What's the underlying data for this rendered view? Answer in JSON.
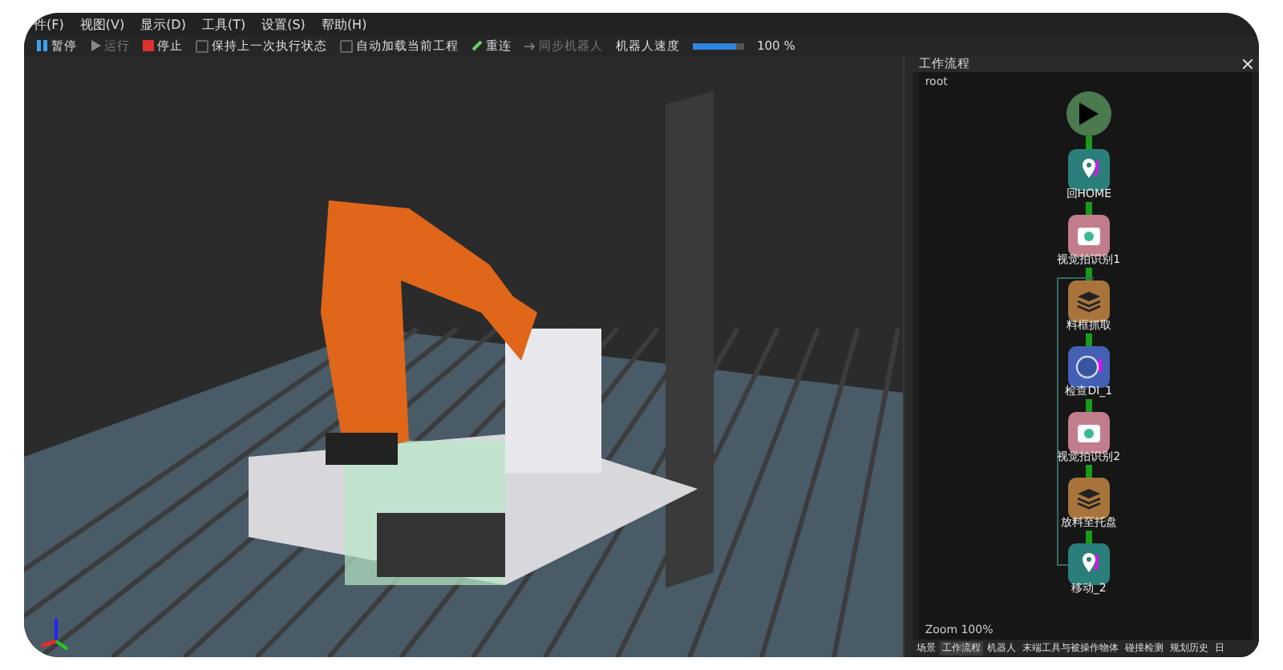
{
  "menu": [
    "件(F)",
    "视图(V)",
    "显示(D)",
    "工具(T)",
    "设置(S)",
    "帮助(H)"
  ],
  "toolbar": {
    "items": [
      {
        "kind": "pause",
        "label": "暂停",
        "disabled": false
      },
      {
        "kind": "run",
        "label": "运行",
        "disabled": true
      },
      {
        "kind": "stop",
        "label": "停止",
        "disabled": false
      },
      {
        "kind": "check",
        "label": "保持上一次执行状态",
        "checked": false
      },
      {
        "kind": "check",
        "label": "自动加载当前工程",
        "checked": false
      },
      {
        "kind": "link",
        "label": "重连",
        "disabled": false
      },
      {
        "kind": "sync",
        "label": "同步机器人",
        "disabled": true
      }
    ],
    "speed": {
      "label": "机器人速度",
      "level": 0.85,
      "value": "100 %"
    }
  },
  "workflow": {
    "title": "工作流程",
    "path": "root",
    "zoom": "Zoom 100%",
    "nodes": [
      {
        "kind": "start"
      },
      {
        "kind": "move",
        "label": "回HOME",
        "color": "#2a7f7a"
      },
      {
        "kind": "camera",
        "label": "视觉拍识别1",
        "color": "#c27d8c"
      },
      {
        "kind": "stack",
        "label": "料框抓取",
        "color": "#a8743c"
      },
      {
        "kind": "di",
        "label": "检查DI_1",
        "color": "#4360b4"
      },
      {
        "kind": "camera",
        "label": "视觉拍识别2",
        "color": "#c27d8c"
      },
      {
        "kind": "stack",
        "label": "放料至托盘",
        "color": "#a8743c"
      },
      {
        "kind": "move",
        "label": "移动_2",
        "color": "#2a7f7a"
      }
    ]
  },
  "bottom_tabs": [
    {
      "label": "场景",
      "selected": false
    },
    {
      "label": "工作流程",
      "selected": true
    },
    {
      "label": "机器人",
      "selected": false
    },
    {
      "label": "末端工具与被操作物体",
      "selected": false
    },
    {
      "label": "碰撞检测",
      "selected": false
    },
    {
      "label": "规划历史",
      "selected": false
    },
    {
      "label": "日",
      "selected": false
    }
  ]
}
